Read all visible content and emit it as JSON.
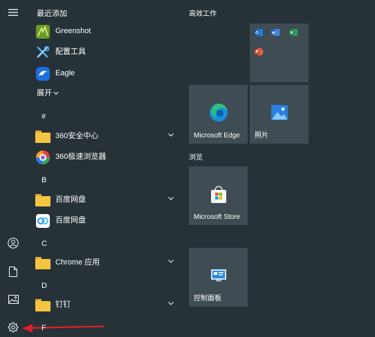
{
  "recent_header": "最近添加",
  "expand_label": "展开",
  "apps": [
    {
      "label": "Greenshot",
      "icon": "greenshot-icon"
    },
    {
      "label": "配置工具",
      "icon": "config-tool-icon"
    },
    {
      "label": "Eagle",
      "icon": "eagle-icon"
    }
  ],
  "sections": {
    "hash": "#",
    "b": "B",
    "c": "C",
    "d": "D",
    "f": "F"
  },
  "list": {
    "a360_safe": "360安全中心",
    "a360_browser": "360极速浏览器",
    "baidu_folder": "百度网盘",
    "baidu_app": "百度网盘",
    "chrome_apps": "Chrome 应用",
    "dingtalk": "钉钉"
  },
  "tile_groups": {
    "productivity": "高效工作",
    "browse": "浏览"
  },
  "tiles": {
    "edge": "Microsoft Edge",
    "photos": "照片",
    "store": "Microsoft Store",
    "control_panel": "控制面板"
  },
  "colors": {
    "background": "#263238",
    "tile": "#3f4c53",
    "annotation_arrow": "#e02020"
  }
}
